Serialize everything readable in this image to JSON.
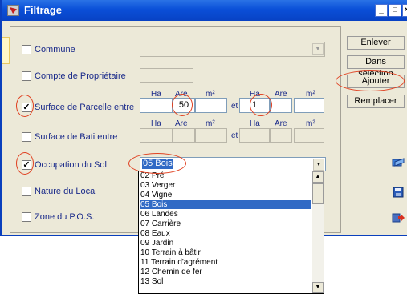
{
  "window": {
    "title": "Filtrage",
    "minimize_label": "_",
    "maximize_label": "□",
    "close_label": "×"
  },
  "filters": {
    "commune": {
      "label": "Commune",
      "checked": false
    },
    "compte": {
      "label": "Compte de Propriétaire",
      "checked": false
    },
    "surface_parcelle": {
      "label": "Surface de Parcelle entre",
      "checked": true,
      "units": [
        "Ha",
        "Are",
        "m²",
        "Ha",
        "Are",
        "m²"
      ],
      "from_ha": "",
      "from_are": "50",
      "from_m2": "",
      "to_ha": "1",
      "to_are": "",
      "to_m2": "",
      "et": "et"
    },
    "surface_bati": {
      "label": "Surface de Bati entre",
      "checked": false,
      "units": [
        "Ha",
        "Are",
        "m²",
        "Ha",
        "Are",
        "m²"
      ],
      "et": "et"
    },
    "occupation": {
      "label": "Occupation du Sol",
      "checked": true,
      "selected": "05 Bois"
    },
    "nature": {
      "label": "Nature du Local",
      "checked": false
    },
    "zone": {
      "label": "Zone du P.O.S.",
      "checked": false
    }
  },
  "buttons": {
    "enlever": "Enlever",
    "dans_selection": "Dans sélection",
    "ajouter": "Ajouter",
    "remplacer": "Remplacer"
  },
  "dropdown": {
    "items": [
      "02 Pré",
      "03 Verger",
      "04 Vigne",
      "05 Bois",
      "06 Landes",
      "07 Carrière",
      "08 Eaux",
      "09 Jardin",
      "10 Terrain à bâtir",
      "11 Terrain d'agrément",
      "12 Chemin de fer",
      "13 Sol"
    ],
    "selected_index": 3
  },
  "checkmark": "✓",
  "colors": {
    "title_bar": "#0a4fd8",
    "selection": "#316ac5",
    "highlight_ellipse": "#e04020"
  }
}
